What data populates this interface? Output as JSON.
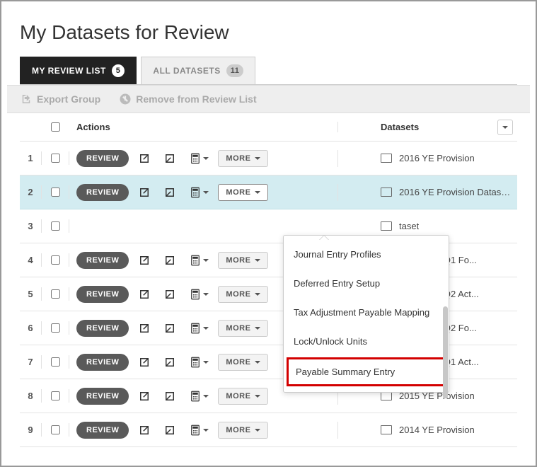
{
  "title": "My Datasets for Review",
  "tabs": {
    "my_list": {
      "label": "MY REVIEW LIST",
      "count": "5"
    },
    "all": {
      "label": "ALL DATASETS",
      "count": "11"
    }
  },
  "toolbar": {
    "export": "Export Group",
    "remove": "Remove from Review List"
  },
  "columns": {
    "actions": "Actions",
    "datasets": "Datasets"
  },
  "buttons": {
    "review": "REVIEW",
    "more": "MORE"
  },
  "rows": [
    {
      "num": "1",
      "dataset": "2016 YE Provision"
    },
    {
      "num": "2",
      "dataset": "2016 YE Provision Dataset ..."
    },
    {
      "num": "3",
      "dataset": "taset"
    },
    {
      "num": "4",
      "dataset": "m Dataset Q1 Fo..."
    },
    {
      "num": "5",
      "dataset": "m Dataset Q2 Act..."
    },
    {
      "num": "6",
      "dataset": "m Dataset Q2 Fo..."
    },
    {
      "num": "7",
      "dataset": "m Dataset Q1 Act..."
    },
    {
      "num": "8",
      "dataset": "2015 YE Provision"
    },
    {
      "num": "9",
      "dataset": "2014 YE Provision"
    }
  ],
  "menu": {
    "items": [
      "Journal Entry Profiles",
      "Deferred Entry Setup",
      "Tax Adjustment Payable Mapping",
      "Lock/Unlock Units",
      "Payable Summary Entry"
    ],
    "highlight_index": 4
  }
}
